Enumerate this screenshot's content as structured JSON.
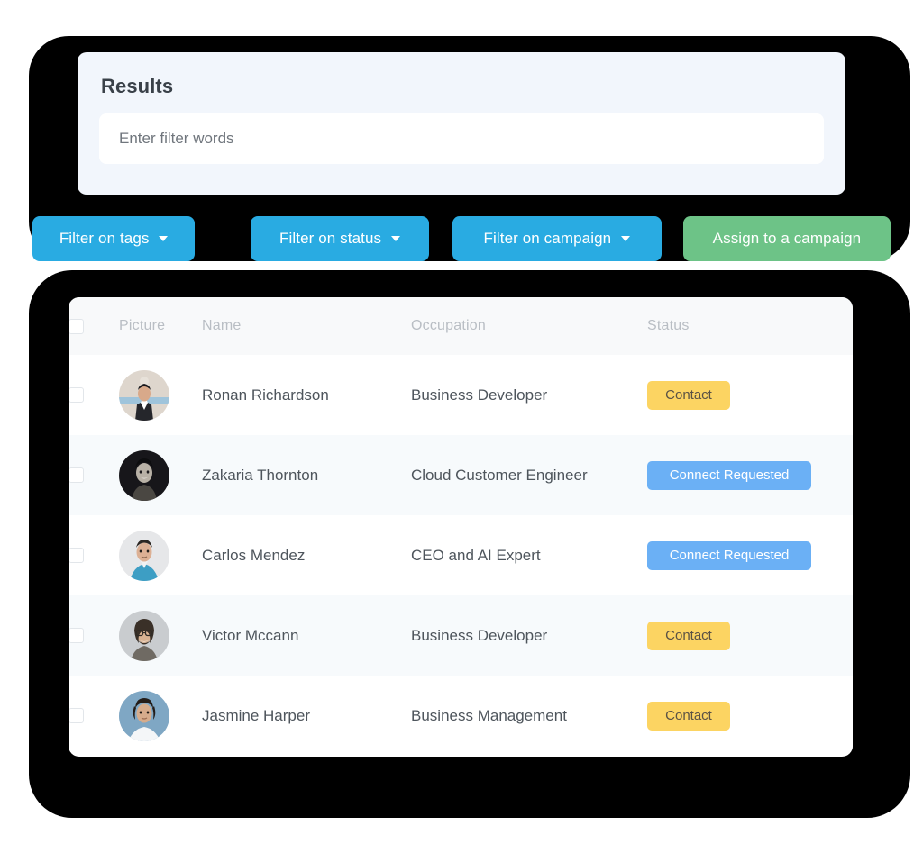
{
  "frame": {
    "color": "#000000"
  },
  "results": {
    "title": "Results",
    "filter_placeholder": "Enter filter words",
    "filter_value": ""
  },
  "toolbar": {
    "buttons": [
      {
        "label": "Filter on tags",
        "style": "blue",
        "has_caret": true,
        "icon": "chevron-down-icon"
      },
      {
        "label": "Filter on status",
        "style": "blue",
        "has_caret": true,
        "icon": "chevron-down-icon"
      },
      {
        "label": "Filter on campaign",
        "style": "blue",
        "has_caret": true,
        "icon": "chevron-down-icon"
      },
      {
        "label": "Assign to a campaign",
        "style": "green",
        "has_caret": false,
        "icon": ""
      }
    ],
    "blue_color": "#29abe2",
    "green_color": "#6dc387"
  },
  "table": {
    "headers": {
      "select_all": "",
      "picture": "Picture",
      "name": "Name",
      "occupation": "Occupation",
      "status": "Status"
    },
    "status_colors": {
      "contact": "#fcd462",
      "connect_requested": "#6bb0f5"
    },
    "rows": [
      {
        "checked": false,
        "avatar": "avatar-ronan",
        "name": "Ronan Richardson",
        "occupation": "Business Developer",
        "status": "Contact",
        "status_type": "contact"
      },
      {
        "checked": false,
        "avatar": "avatar-zakaria",
        "name": "Zakaria Thornton",
        "occupation": "Cloud Customer Engineer",
        "status": "Connect Requested",
        "status_type": "connect_requested"
      },
      {
        "checked": false,
        "avatar": "avatar-carlos",
        "name": "Carlos Mendez",
        "occupation": "CEO and AI Expert",
        "status": "Connect Requested",
        "status_type": "connect_requested"
      },
      {
        "checked": false,
        "avatar": "avatar-victor",
        "name": "Victor Mccann",
        "occupation": "Business Developer",
        "status": "Contact",
        "status_type": "contact"
      },
      {
        "checked": false,
        "avatar": "avatar-jasmine",
        "name": "Jasmine Harper",
        "occupation": "Business Management",
        "status": "Contact",
        "status_type": "contact"
      }
    ]
  }
}
